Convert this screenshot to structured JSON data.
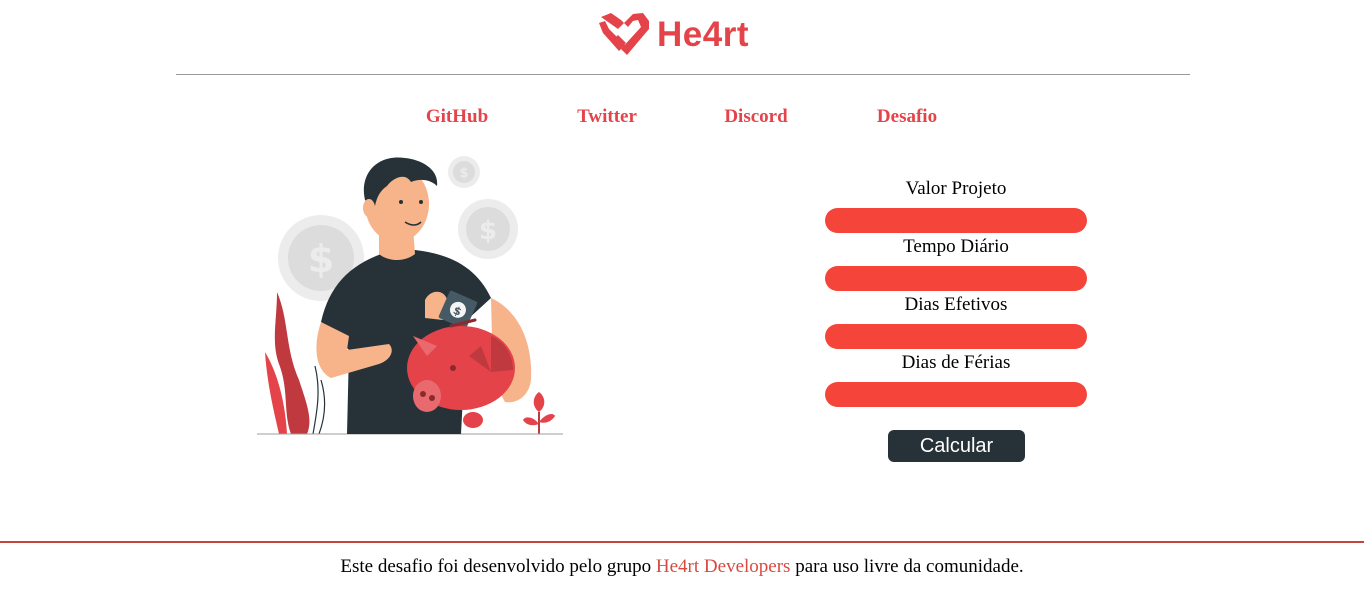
{
  "header": {
    "logo_text": "He4rt",
    "brand_color": "#e4434a"
  },
  "nav": {
    "items": [
      {
        "label": "GitHub"
      },
      {
        "label": "Twitter"
      },
      {
        "label": "Discord"
      },
      {
        "label": "Desafio"
      }
    ]
  },
  "illustration": {
    "icon": "piggy-bank-saving-illustration"
  },
  "form": {
    "fields": [
      {
        "label": "Valor Projeto",
        "value": "",
        "placeholder": ""
      },
      {
        "label": "Tempo Diário",
        "value": "",
        "placeholder": ""
      },
      {
        "label": "Dias Efetivos",
        "value": "",
        "placeholder": ""
      },
      {
        "label": "Dias de Férias",
        "value": "",
        "placeholder": ""
      }
    ],
    "input_color": "#f54439",
    "submit_label": "Calcular",
    "submit_color": "#263238"
  },
  "footer": {
    "text_before": "Este desafio foi desenvolvido pelo grupo ",
    "link_text": "He4rt Developers",
    "text_after": " para uso livre da comunidade."
  }
}
